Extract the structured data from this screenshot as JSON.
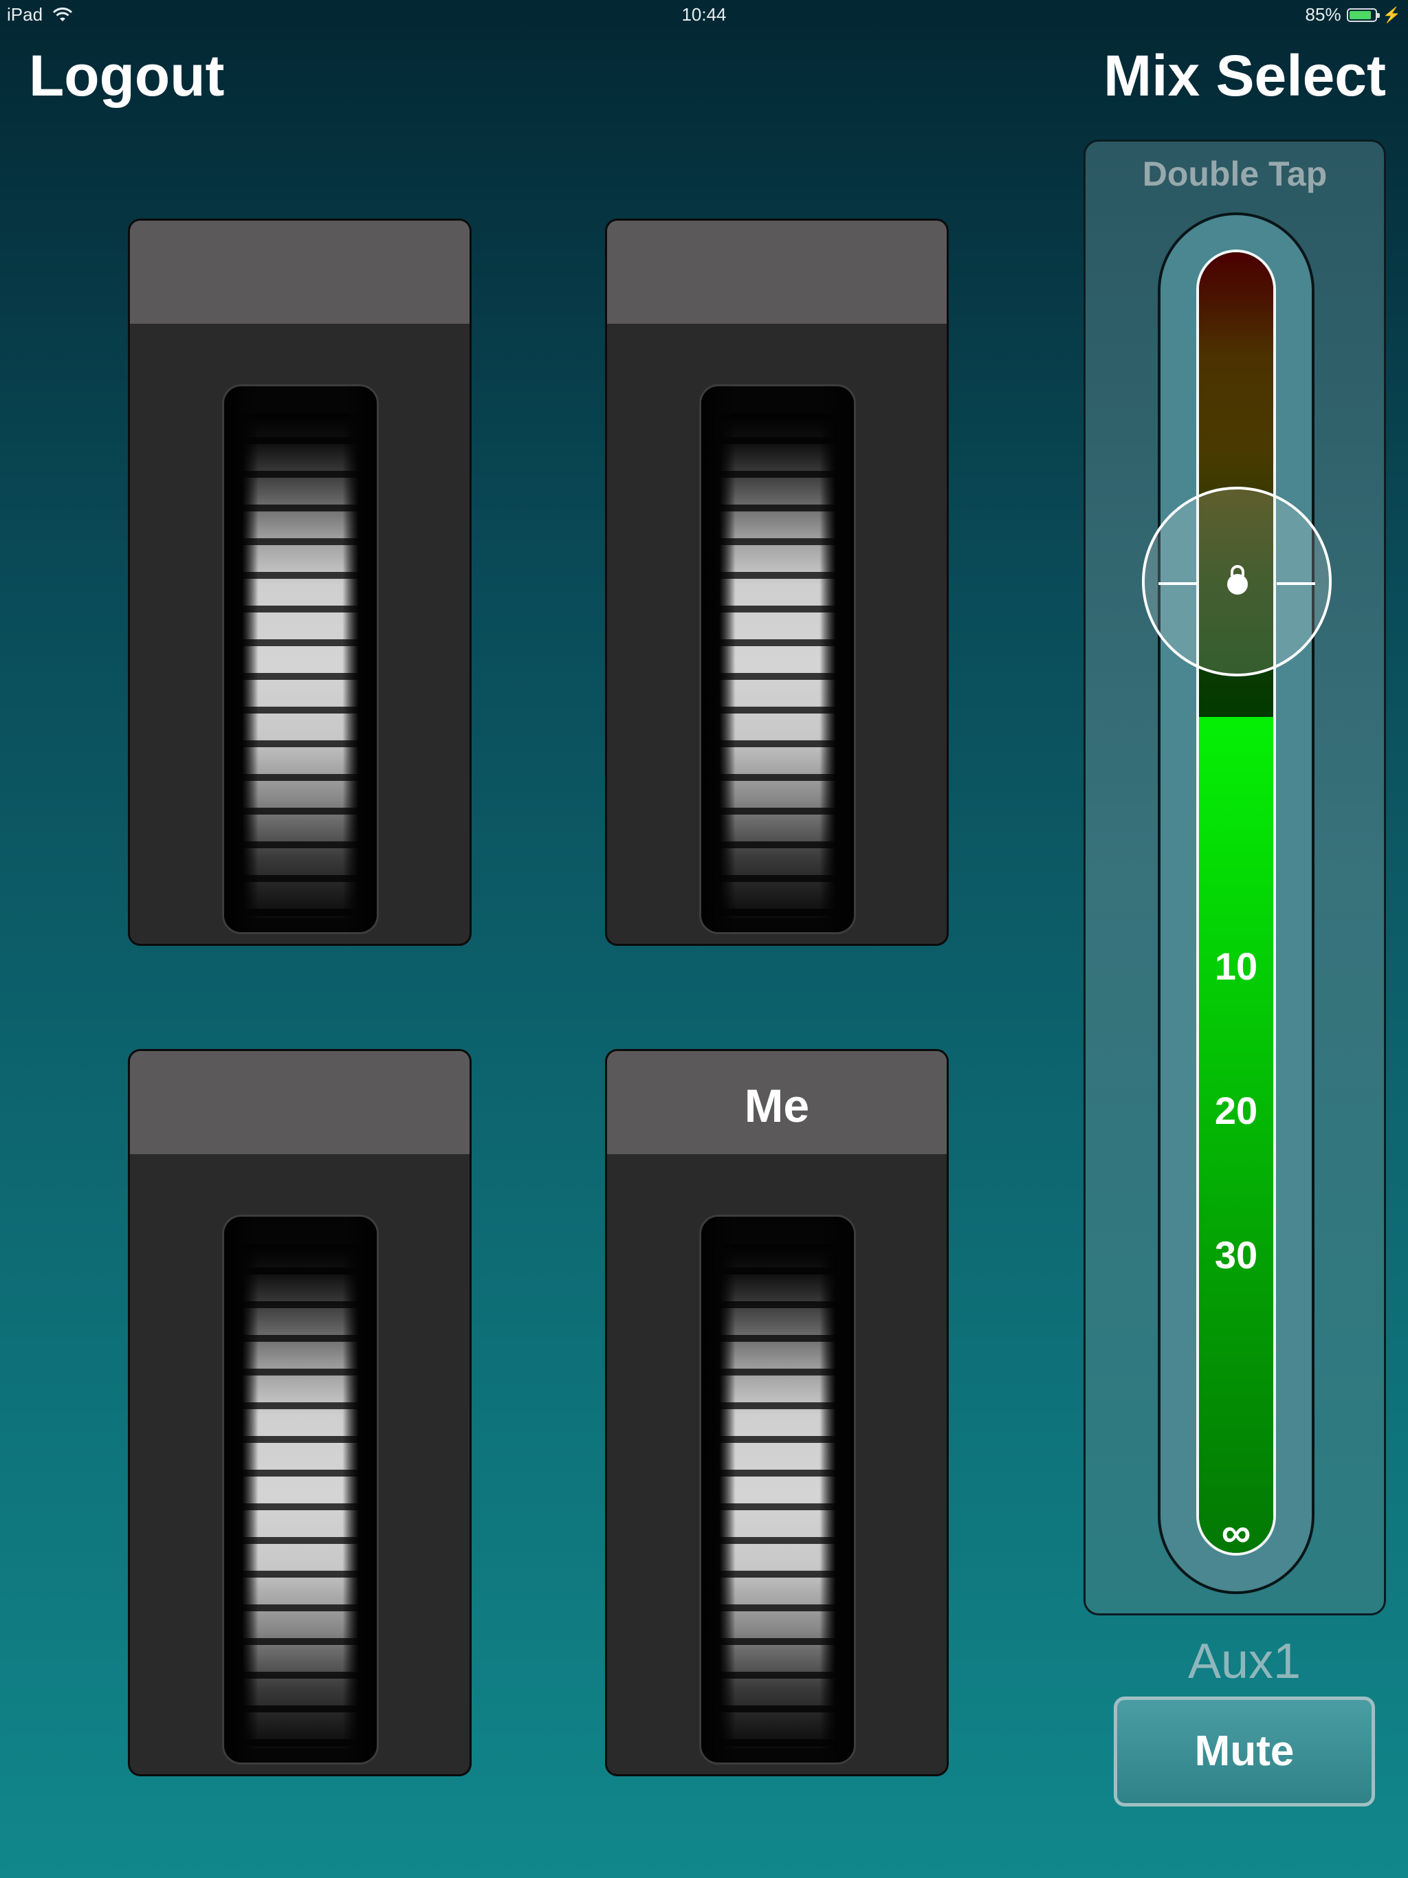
{
  "status_bar": {
    "device": "iPad",
    "time": "10:44",
    "battery": "85%",
    "battery_level": 0.85
  },
  "nav": {
    "logout_label": "Logout",
    "mix_select_label": "Mix Select"
  },
  "channels": [
    {
      "label": ""
    },
    {
      "label": ""
    },
    {
      "label": ""
    },
    {
      "label": "Me"
    }
  ],
  "master": {
    "hint": "Double Tap",
    "scale_labels": [
      "10",
      "20",
      "30",
      "∞"
    ],
    "fader_level": 0.75,
    "meter_level": 0.64,
    "bus_name": "Aux1",
    "mute_label": "Mute"
  },
  "colors": {
    "background_top": "#032733",
    "background_bottom": "#11878b",
    "channel_header": "#5b595a",
    "channel_body": "#2a2a2b",
    "meter_green": "#05f005",
    "battery_green": "#4cd964"
  }
}
